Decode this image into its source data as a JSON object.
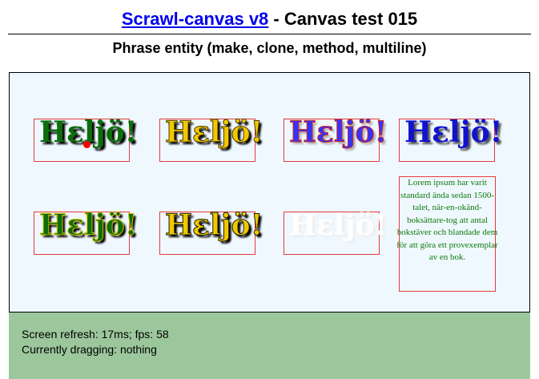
{
  "header": {
    "link_text": "Scrawl-canvas v8",
    "title_rest": " - Canvas test 015",
    "subtitle": "Phrase entity (make, clone, method, multiline)"
  },
  "phrases": [
    {
      "text": "Hɛljö!",
      "fill": "#0b6e0b",
      "shadow": "#000000",
      "stroke": "none",
      "pivot": true
    },
    {
      "text": "Hɛljö!",
      "fill": "#f0c800",
      "shadow": "#000000",
      "stroke": "#4d3a00"
    },
    {
      "text": "Hɛljö!",
      "fill": "#3333ff",
      "shadow": "#b0b0b0",
      "stroke": "#d1271b"
    },
    {
      "text": "Hɛljö!",
      "fill": "#1212cc",
      "shadow": "#555555",
      "stroke": "none"
    },
    {
      "text": "Hɛljö!",
      "fill": "#0b6e0b",
      "shadow": "#000000",
      "stroke": "#d4c100"
    },
    {
      "text": "Hɛljö!",
      "fill": "#f0c800",
      "shadow": "#000000",
      "stroke": "#1a1a00"
    },
    {
      "text": "Hɛljö!",
      "fill": "#ffffff",
      "shadow": "#eeeeee",
      "stroke": "none"
    }
  ],
  "multiline": {
    "text": "Lorem ipsum har varit standard ända sedan 1500-talet, när-en-okänd-boksättare-tog att antal bokstäver och blandade dem för att göra ett provexemplar av en bok.",
    "color": "#0b7a0b"
  },
  "report": {
    "refresh_line": "Screen refresh: 17ms; fps: 58",
    "dragging_line": "Currently dragging: nothing"
  },
  "colors": {
    "canvas_background": "#f0f8ff",
    "report_background": "#9cc79c",
    "box_border": "#e23c3c"
  }
}
